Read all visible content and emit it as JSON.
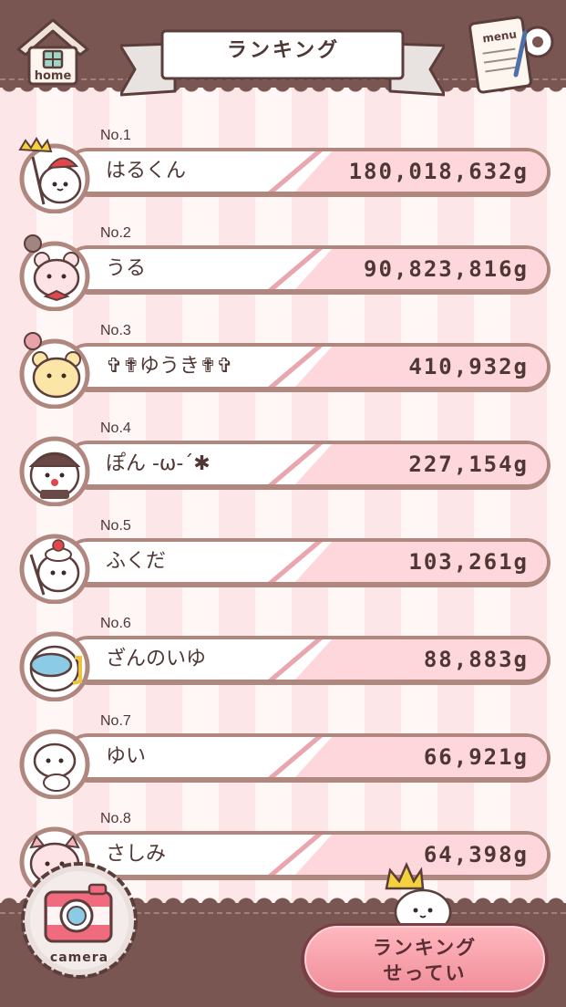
{
  "header": {
    "home_label": "home",
    "title": "ランキング",
    "menu_label": "menu"
  },
  "ranking": [
    {
      "no": "No.1",
      "name": "はるくん",
      "score": "180,018,632g",
      "avatar": "seal-king-avatar"
    },
    {
      "no": "No.2",
      "name": "うる",
      "score": "90,823,816g",
      "avatar": "bear-ribbon-avatar"
    },
    {
      "no": "No.3",
      "name": "✞✟ゆうき✟✞",
      "score": "410,932g",
      "avatar": "yellow-bear-avatar"
    },
    {
      "no": "No.4",
      "name": "ぽん -ω-´✱",
      "score": "227,154g",
      "avatar": "seal-beret-avatar"
    },
    {
      "no": "No.5",
      "name": "ふくだ",
      "score": "103,261g",
      "avatar": "seal-cherry-avatar"
    },
    {
      "no": "No.6",
      "name": "ざんのいゆ",
      "score": "88,883g",
      "avatar": "seal-goggles-avatar"
    },
    {
      "no": "No.7",
      "name": "ゆい",
      "score": "66,921g",
      "avatar": "seal-baby-avatar"
    },
    {
      "no": "No.8",
      "name": "さしみ",
      "score": "64,398g",
      "avatar": "seal-pig-avatar"
    }
  ],
  "footer": {
    "camera_label": "camera",
    "settings_line1": "ランキング",
    "settings_line2": "せってい"
  },
  "colors": {
    "brown": "#7a5652",
    "pink": "#fdd7db",
    "accent": "#f08f9b"
  }
}
